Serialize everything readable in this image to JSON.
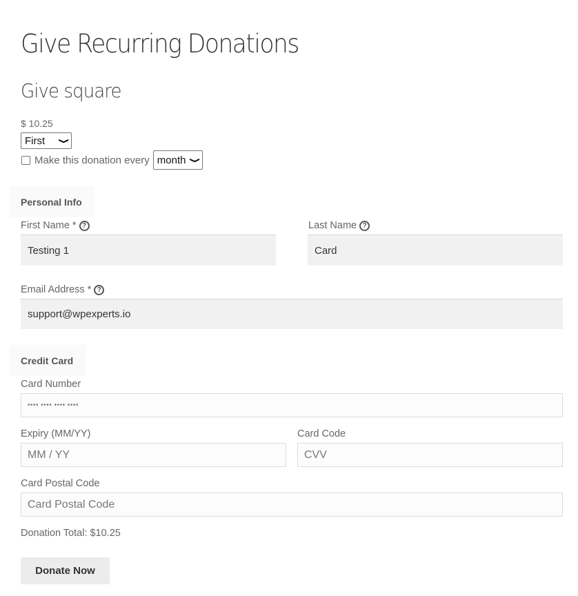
{
  "page": {
    "title": "Give Recurring Donations",
    "form_title": "Give square"
  },
  "amount": {
    "display": "$ 10.25"
  },
  "level_select": {
    "selected": "First"
  },
  "recurring": {
    "checked": false,
    "label": "Make this donation every",
    "period_selected": "month"
  },
  "personal_info": {
    "legend": "Personal Info",
    "first_name": {
      "label": "First Name *",
      "value": "Testing 1"
    },
    "last_name": {
      "label": "Last Name",
      "value": "Card"
    },
    "email": {
      "label": "Email Address *",
      "value": "support@wpexperts.io"
    }
  },
  "credit_card": {
    "legend": "Credit Card",
    "card_number": {
      "label": "Card Number",
      "placeholder": "•••• •••• •••• ••••"
    },
    "expiry": {
      "label": "Expiry (MM/YY)",
      "placeholder": "MM / YY"
    },
    "cvv": {
      "label": "Card Code",
      "placeholder": "CVV"
    },
    "postal": {
      "label": "Card Postal Code",
      "placeholder": "Card Postal Code"
    }
  },
  "summary": {
    "total": "Donation Total: $10.25"
  },
  "actions": {
    "donate_label": "Donate Now"
  },
  "icons": {
    "help": "?",
    "chevron": "❯"
  }
}
